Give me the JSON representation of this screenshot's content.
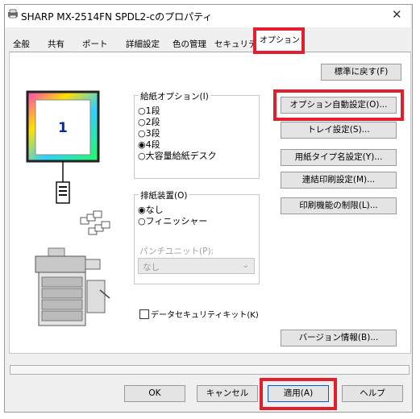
{
  "window": {
    "title": "SHARP MX-2514FN SPDL2-cのプロパティ",
    "close_glyph": "✕"
  },
  "tabs": [
    "全般",
    "共有",
    "ポート",
    "詳細設定",
    "色の管理",
    "セキュリティ"
  ],
  "selected_tab": "オプション",
  "preview": {
    "page_number": "1"
  },
  "paper_options": {
    "label": "給紙オプション(I)",
    "options": [
      "1段",
      "2段",
      "3段",
      "4段",
      "大容量給紙デスク"
    ],
    "selected": "4段"
  },
  "output_device": {
    "label": "排紙装置(O)",
    "options": [
      "なし",
      "フィニッシャー"
    ],
    "selected": "なし",
    "punch_label": "パンチユニット(P):",
    "punch_value": "なし"
  },
  "security_kit_label": "データセキュリティキット(K)",
  "side_buttons": {
    "reset": "標準に戻す(F)",
    "auto_config": "オプション自動設定(O)...",
    "tray": "トレイ設定(S)...",
    "paper_type": "用紙タイプ名設定(Y)...",
    "continuous": "連結印刷設定(M)...",
    "restriction": "印刷機能の制限(L)...",
    "version": "バージョン情報(B)..."
  },
  "footer": {
    "ok": "OK",
    "cancel": "キャンセル",
    "apply": "適用(A)",
    "help": "ヘルプ"
  },
  "colors": {
    "highlight": "#e0202c",
    "selected_tab_text": "#000000"
  }
}
